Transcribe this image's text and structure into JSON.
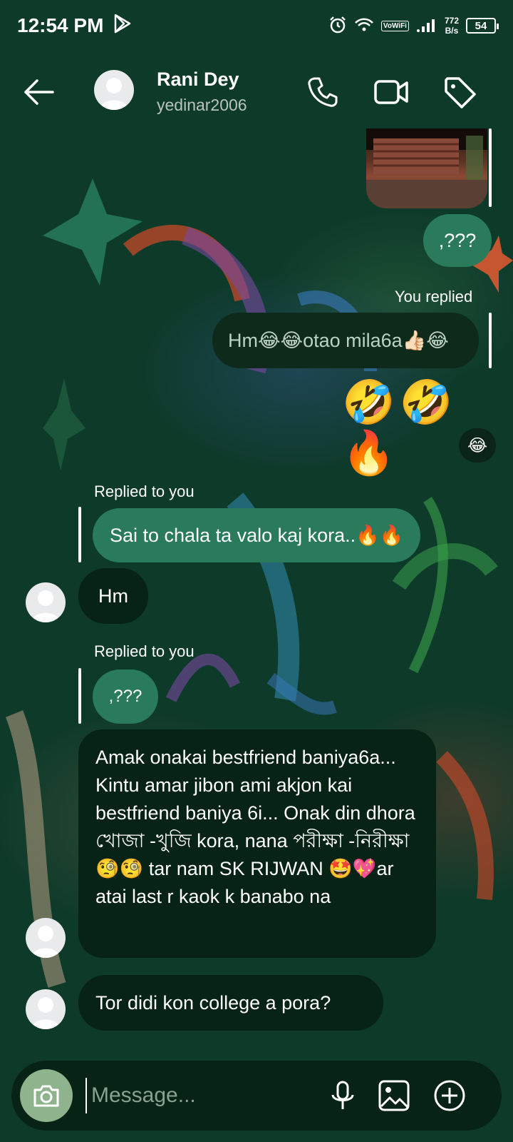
{
  "status": {
    "time": "12:54 PM",
    "vowifi": "VoWiFi",
    "netspeed_value": "772",
    "netspeed_unit": "B/s",
    "battery": "54"
  },
  "header": {
    "name": "Rani Dey",
    "username": "yedinar2006",
    "icons": [
      "back-arrow-icon",
      "phone-icon",
      "video-camera-icon",
      "tag-icon"
    ]
  },
  "messages": {
    "m1_text": ",???",
    "m2_meta": "You replied",
    "m2_text": "Hm😂😂otao mila6a👍🏻😂",
    "m3_emoji": "🤣🤣🔥",
    "m3_reaction": "😂",
    "m4_meta": "Replied to you",
    "m4_text": "Sai to chala ta valo kaj kora..🔥🔥",
    "m5_text": "Hm",
    "m6_meta": "Replied to you",
    "m6_text": ",???",
    "m7_text": "Amak onakai bestfriend baniya6a... Kintu amar jibon ami akjon kai bestfriend baniya 6i... Onak din dhora খোজা -খুজি kora, nana পরীক্ষা -নিরীক্ষা 🧐🧐 tar nam SK RIJWAN 🤩💖ar atai last r kaok k banabo na",
    "m8_text": "Tor didi kon college a pora?"
  },
  "composer": {
    "placeholder": "Message...",
    "icons": [
      "camera-icon",
      "microphone-icon",
      "gallery-icon",
      "add-icon"
    ]
  },
  "colors": {
    "background": "#0e3a2a",
    "outgoing_bubble": "#2a7a5c",
    "incoming_bubble": "#062315",
    "camera_button": "#8fb48d"
  }
}
